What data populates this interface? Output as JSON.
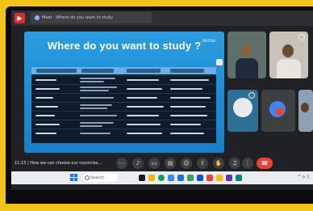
{
  "window": {
    "tab_title": "Meet - Where do you want to study"
  },
  "slide": {
    "title": "Where do you want to study ?",
    "logo_text": "BRITISH",
    "table": {
      "rows": 10
    }
  },
  "participants": [
    {
      "name": ""
    },
    {
      "name": ""
    },
    {
      "name": ""
    },
    {
      "name": ""
    }
  ],
  "meetbar": {
    "time_label": "11:15 | How we can choose our countries..."
  },
  "taskbar": {
    "search_placeholder": "Search"
  },
  "colors": {
    "frame": "#f0c419",
    "slide_blue": "#1e8bd4",
    "end_call": "#ea4335"
  }
}
